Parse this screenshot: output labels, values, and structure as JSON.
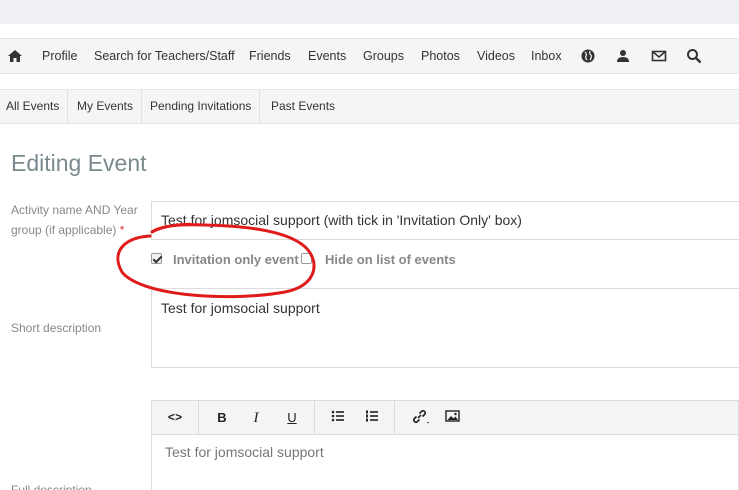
{
  "main_nav": {
    "items": [
      {
        "label": "Profile"
      },
      {
        "label": "Search for Teachers/Staff"
      },
      {
        "label": "Friends"
      },
      {
        "label": "Events"
      },
      {
        "label": "Groups"
      },
      {
        "label": "Photos"
      },
      {
        "label": "Videos"
      },
      {
        "label": "Inbox"
      }
    ],
    "icons": [
      "home-icon",
      "globe-icon",
      "user-add-icon",
      "envelope-icon",
      "search-icon"
    ]
  },
  "sub_nav": {
    "tabs": [
      {
        "label": "All Events"
      },
      {
        "label": "My Events"
      },
      {
        "label": "Pending Invitations"
      },
      {
        "label": "Past Events"
      }
    ]
  },
  "form": {
    "title": "Editing Event",
    "activity_label": "Activity name AND Year group (if applicable)",
    "required_mark": "*",
    "activity_value": "Test for jomsocial support (with tick in 'Invitation Only' box)",
    "invitation_only_label": "Invitation only event",
    "invitation_only_checked": true,
    "hide_label": "Hide on list of events",
    "hide_checked": false,
    "short_desc_label": "Short description",
    "short_desc_value": "Test for jomsocial support",
    "full_desc_label": "Full description",
    "full_desc_value": "Test for jomsocial support"
  },
  "editor_toolbar": {
    "code": "<>",
    "bold": "B",
    "italic": "I",
    "underline": "U"
  },
  "colors": {
    "annotation": "#e01b1b",
    "nav_bg": "#f4f5f6",
    "title": "#7a8a8e"
  }
}
